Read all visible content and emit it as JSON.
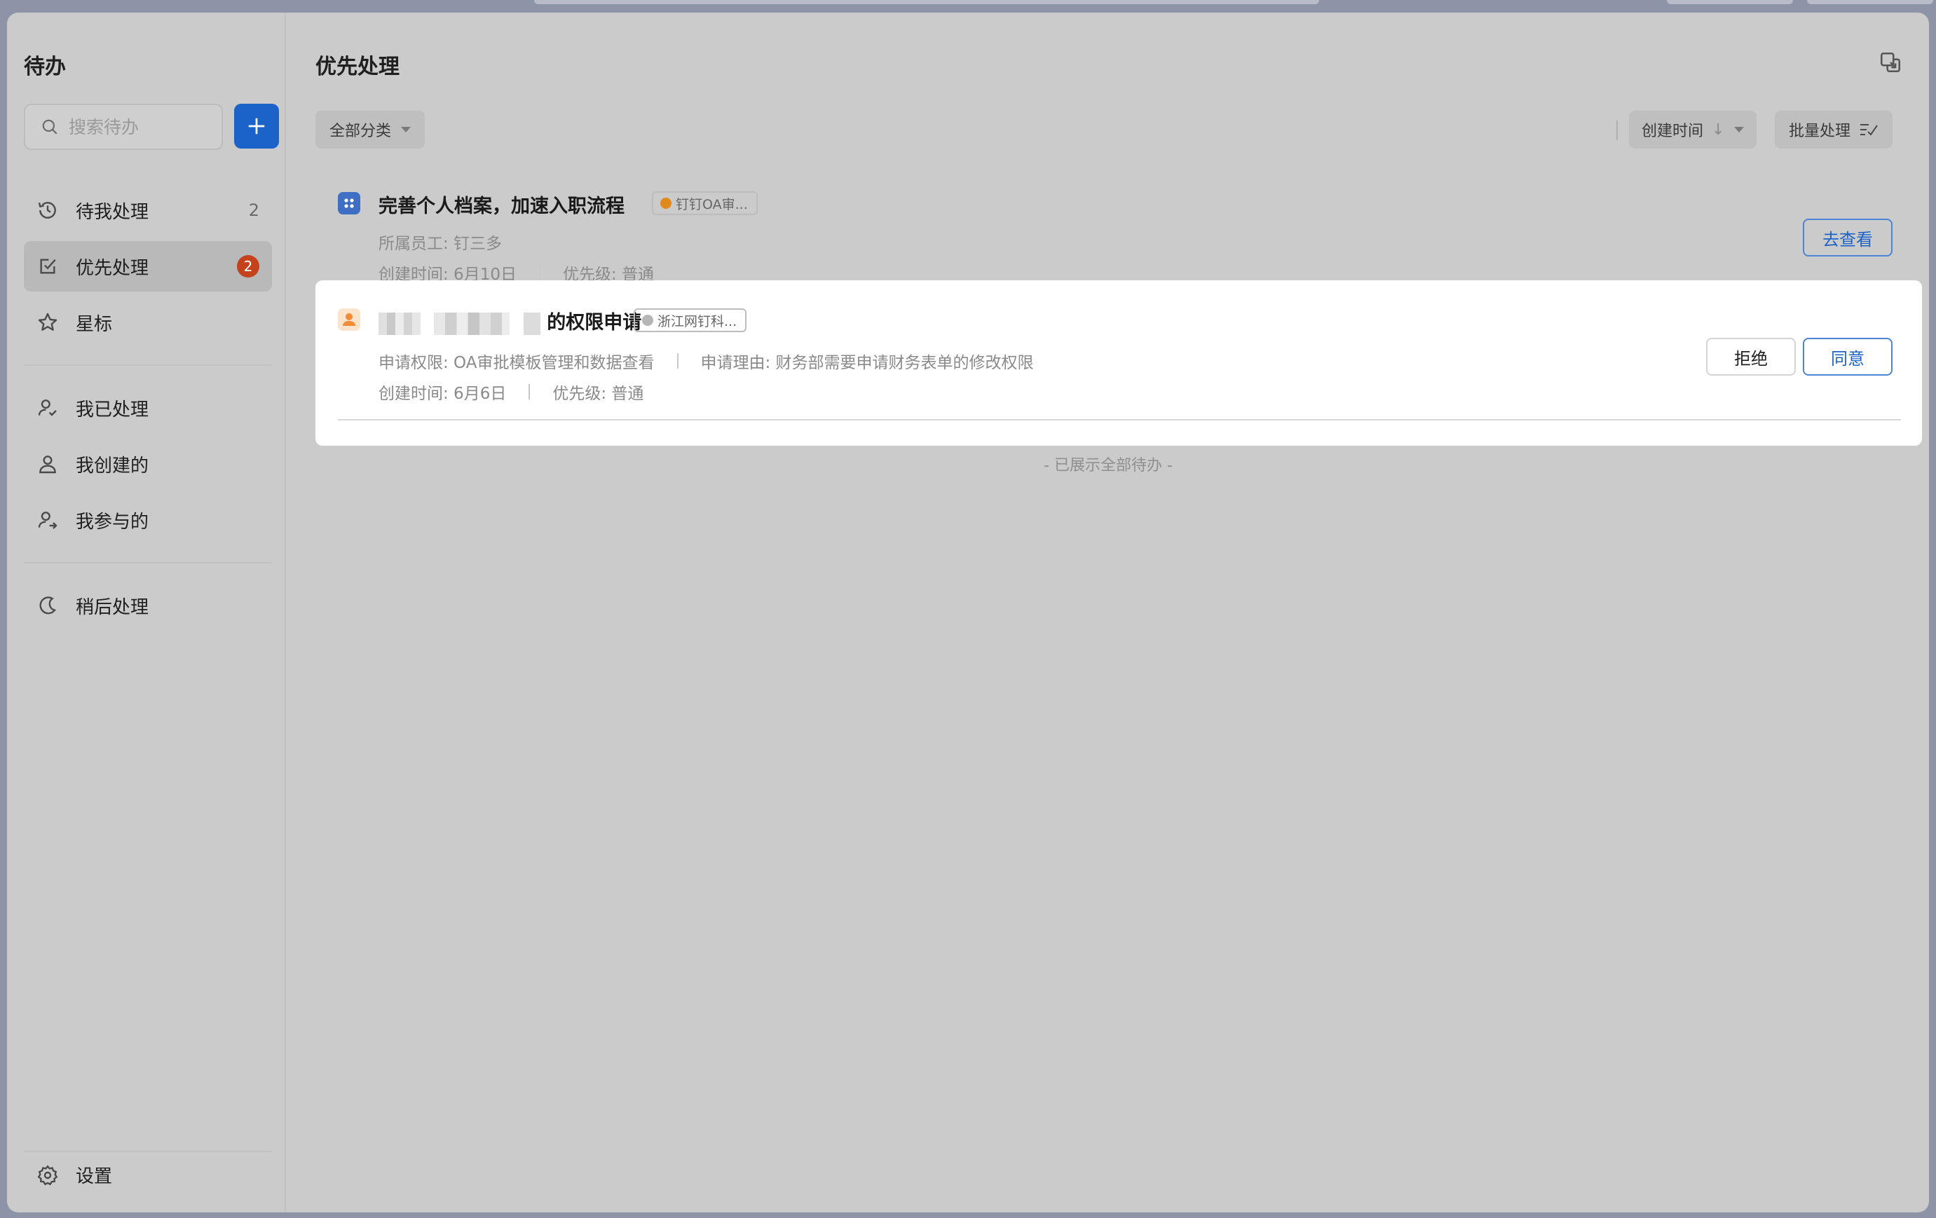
{
  "sidebar": {
    "title": "待办",
    "search_placeholder": "搜索待办",
    "items": [
      {
        "label": "待我处理",
        "count": "2"
      },
      {
        "label": "优先处理",
        "badge": "2"
      },
      {
        "label": "星标"
      },
      {
        "label": "我已处理"
      },
      {
        "label": "我创建的"
      },
      {
        "label": "我参与的"
      },
      {
        "label": "稍后处理"
      }
    ],
    "settings_label": "设置"
  },
  "main": {
    "title": "优先处理",
    "filter_label": "全部分类",
    "sort_label": "创建时间",
    "batch_label": "批量处理",
    "end_note": "- 已展示全部待办 -"
  },
  "tasks": [
    {
      "title": "完善个人档案，加速入职流程",
      "tag": "钉钉OA审...",
      "meta_line1": [
        "所属员工: 钉三多"
      ],
      "created": "创建时间: 6月10日",
      "priority": "优先级: 普通",
      "action_label": "去查看",
      "icon_color": "#3f6fc4",
      "tag_dot_color": "#e08a1e"
    },
    {
      "title_suffix": "的权限申请",
      "tag": "浙江网钉科...",
      "meta_line1": [
        "申请权限: OA审批模板管理和数据查看",
        "申请理由: 财务部需要申请财务表单的修改权限"
      ],
      "created": "创建时间: 6月6日",
      "priority": "优先级: 普通",
      "reject_label": "拒绝",
      "approve_label": "同意",
      "icon_color": "#f6a860",
      "tag_dot_color": "#b5b5b5"
    }
  ],
  "colors": {
    "accent": "#1b63c9",
    "badge": "#c4421c",
    "background": "#cbcbcb"
  }
}
